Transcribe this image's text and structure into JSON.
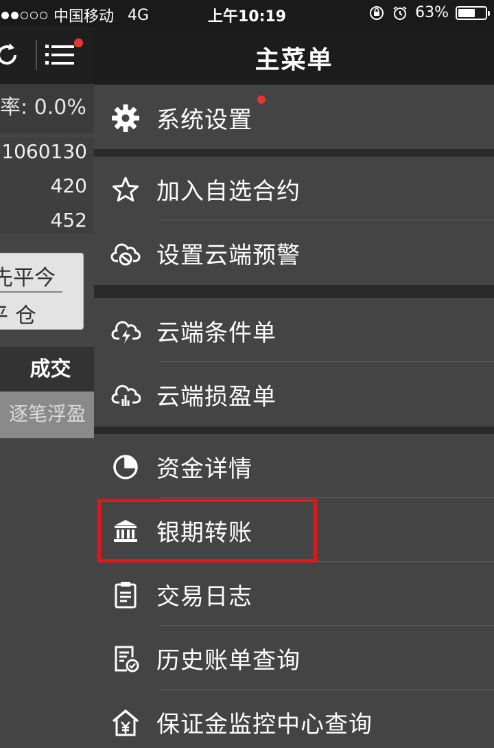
{
  "status_bar": {
    "carrier": "中国移动",
    "network": "4G",
    "time": "上午10:19",
    "battery_text": "63%",
    "battery_level": 0.63
  },
  "left_panel": {
    "rate_text": "率: 0.0%",
    "numbers": [
      "1060130",
      "420",
      "452"
    ],
    "box_line1": "先平今",
    "box_line2": "平 仓",
    "deal_label": "成交",
    "float_label": "逐笔浮盈"
  },
  "drawer": {
    "title": "主菜单",
    "groups": [
      {
        "items": [
          {
            "label": "系统设置",
            "icon": "gear-icon",
            "badge": true
          }
        ]
      },
      {
        "items": [
          {
            "label": "加入自选合约",
            "icon": "star-icon"
          },
          {
            "label": "设置云端预警",
            "icon": "cloud-alert-icon"
          }
        ]
      },
      {
        "items": [
          {
            "label": "云端条件单",
            "icon": "cloud-bolt-icon"
          },
          {
            "label": "云端损盈单",
            "icon": "cloud-chart-icon"
          }
        ]
      },
      {
        "items": [
          {
            "label": "资金详情",
            "icon": "pie-chart-icon"
          },
          {
            "label": "银期转账",
            "icon": "bank-icon",
            "highlighted": true
          },
          {
            "label": "交易日志",
            "icon": "clipboard-icon"
          },
          {
            "label": "历史账单查询",
            "icon": "bill-check-icon"
          },
          {
            "label": "保证金监控中心查询",
            "icon": "yuan-home-icon"
          }
        ]
      }
    ]
  },
  "colors": {
    "highlight": "#e0161e",
    "badge": "#e8372f"
  }
}
